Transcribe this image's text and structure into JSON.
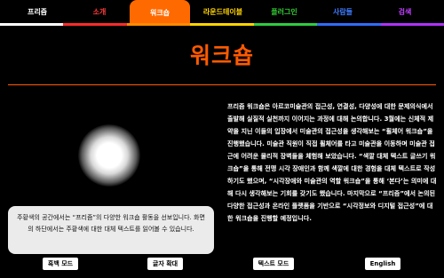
{
  "nav": {
    "items": [
      {
        "label": "프리즘",
        "color": "#ffffff",
        "active": false
      },
      {
        "label": "소개",
        "color": "#ff3b3b",
        "active": false
      },
      {
        "label": "워크숍",
        "color": "#ffffff",
        "active": true
      },
      {
        "label": "라운드테이블",
        "color": "#ffd400",
        "active": false
      },
      {
        "label": "플러그인",
        "color": "#33cc33",
        "active": false
      },
      {
        "label": "사람들",
        "color": "#3d7bff",
        "active": false
      },
      {
        "label": "검색",
        "color": "#c040ff",
        "active": false
      }
    ],
    "rainbow_colors": [
      "#ffffff",
      "#ff2a2a",
      "#ff8a00",
      "#ffd400",
      "#2ecc40",
      "#2f6bff",
      "#b030ff"
    ]
  },
  "page": {
    "title": "워크숍",
    "accent_color": "#ff5a00"
  },
  "description_card": {
    "text": "주황색의 공간에서는 “프리즘”의 다양한 워크숍 활동을 선보입니다. 화면의 하단에서는 주황색에 대한 대체 텍스트를 읽어볼 수 있습니다."
  },
  "buttons": {
    "dark_mode": "흑백 모드",
    "zoom": "글자 확대",
    "text_mode": "텍스트 모드",
    "english": "English"
  },
  "body": {
    "text": "프리즘 워크숍은 아르코미술관의 접근성, 연결성, 다양성에 대한 문제의식에서 출발해 실질적 실천까지 이어지는 과정에 대해 논의합니다. 3월에는 신체적 제약을 지닌 이들의 입장에서 미술관의 접근성을 생각해보는 “휠체어 워크숍”을 진행했습니다. 미술관 직원이 직접 휠체어를 타고 미술관을 이동하며 미술관 접근에 어려운 물리적 장벽들을 체험해 보았습니다. “색깔 대체 텍스트 글쓰기 워크숍”을 통해 전맹 시각 장애인과 함께 색깔에 대한 경험을 대체 텍스트로 작성하기도 했으며, “시각장애와 미술관의 역할 워크숍”을 통해 ‘본다’는 의미에 대해 다시 생각해보는 기회를 갖기도 했습니다. 마지막으로 “프리즘”에서 논의된 다양한 접근성과 온라인 플랫폼을 기반으로 “시각정보와 디지털 접근성”에 대한 워크숍을 진행할 예정입니다."
  }
}
